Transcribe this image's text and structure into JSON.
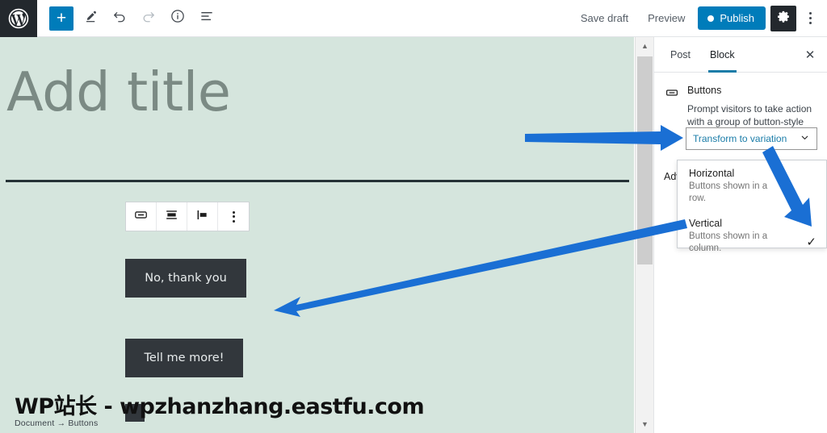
{
  "topbar": {
    "logo_icon": "wordpress-logo-icon",
    "tools": [
      {
        "name": "add-block-button",
        "icon": "plus-icon",
        "label": "+"
      },
      {
        "name": "edit-mode-button",
        "icon": "pencil-icon",
        "label": ""
      },
      {
        "name": "undo-button",
        "icon": "undo-arrow-icon",
        "label": ""
      },
      {
        "name": "redo-button",
        "icon": "redo-arrow-icon",
        "label": ""
      },
      {
        "name": "details-button",
        "icon": "info-circle-icon",
        "label": ""
      },
      {
        "name": "list-view-button",
        "icon": "list-view-icon",
        "label": ""
      }
    ],
    "save_draft_label": "Save draft",
    "preview_label": "Preview",
    "publish_label": "Publish",
    "settings_icon": "gear-icon",
    "more_icon": "kebab-menu-icon",
    "accent_color": "#007cba",
    "admin_bar_color": "#23282d"
  },
  "editor": {
    "background_color": "#d5e5dd",
    "title_placeholder": "Add title",
    "separator_icon": "horizontal-rule",
    "block_toolbar": [
      {
        "name": "block-type-buttons-icon",
        "icon": "buttons-block-icon"
      },
      {
        "name": "change-vertical-alignment-icon",
        "icon": "vertical-align-icon"
      },
      {
        "name": "change-items-justification-icon",
        "icon": "justify-left-icon"
      },
      {
        "name": "more-options-icon",
        "icon": "vertical-dots-icon"
      }
    ],
    "buttons": [
      {
        "label": "No, thank you",
        "color": "#32373c"
      },
      {
        "label": "Tell me more!",
        "color": "#32373c"
      },
      {
        "label": "",
        "color": "#32373c"
      }
    ],
    "scrollbar": {
      "up_arrow": "▲",
      "down_arrow": "▼"
    }
  },
  "sidebar": {
    "tabs": [
      {
        "label": "Post",
        "active": false
      },
      {
        "label": "Block",
        "active": true
      }
    ],
    "active_tab_underline_color": "#1a7ca8",
    "close_label": "✕",
    "block": {
      "icon": "buttons-block-icon",
      "name": "Buttons",
      "description": "Prompt visitors to take action with a group of button-style links."
    },
    "transform_select": {
      "label": "Transform to variation",
      "chevron": "⌄",
      "text_color": "#1a7ca8"
    },
    "advanced_label": "Advanced",
    "dropdown": {
      "options": [
        {
          "title": "Horizontal",
          "subtitle": "Buttons shown in a row.",
          "checked": false,
          "check_glyph": ""
        },
        {
          "title": "Vertical",
          "subtitle": "Buttons shown in a column.",
          "checked": true,
          "check_glyph": "✓"
        }
      ]
    }
  },
  "annotations": {
    "arrow_color": "#1a6fd4",
    "arrows": [
      {
        "name": "arrow-to-transform-select",
        "direction": "right"
      },
      {
        "name": "arrow-to-vertical-checkmark",
        "direction": "down-right"
      },
      {
        "name": "arrow-to-vertical-buttons",
        "direction": "down-left"
      }
    ]
  },
  "statusbar": {
    "breadcrumb": "Document  →  Buttons"
  },
  "watermark": {
    "text": "WP站长 - wpzhanzhang.eastfu.com"
  }
}
